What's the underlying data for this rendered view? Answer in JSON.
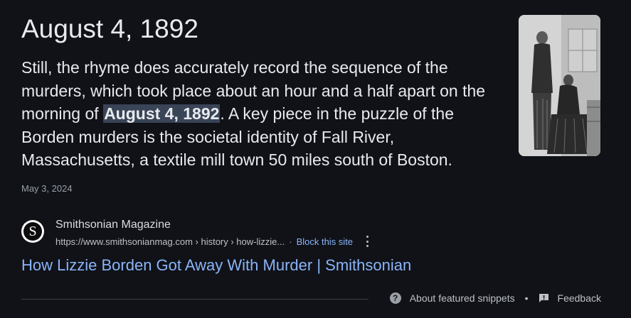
{
  "featured_snippet": {
    "answer_title": "August 4, 1892",
    "text_before": "Still, the rhyme does accurately record the sequence of the murders, which took place about an hour and a half apart on the morning of ",
    "text_highlight": "August 4, 1892",
    "text_after": ". A key piece in the puzzle of the Borden murders is the societal identity of Fall River, Massachusetts, a textile mill town 50 miles south of Boston.",
    "date": "May 3, 2024",
    "thumbnail_icon": "courtroom-illustration-image"
  },
  "source": {
    "favicon_letter": "S",
    "name": "Smithsonian Magazine",
    "url": "https://www.smithsonianmag.com › history › how-lizzie...",
    "separator": "·",
    "block_label": "Block this site",
    "more_icon": "more-vert-icon"
  },
  "result": {
    "title": "How Lizzie Borden Got Away With Murder | Smithsonian"
  },
  "footer": {
    "about_label": "About featured snippets",
    "bullet": "•",
    "feedback_label": "Feedback",
    "help_icon_glyph": "?"
  },
  "colors": {
    "background": "#101218",
    "text": "#e8eaed",
    "link": "#8ab4f8",
    "highlight": "#394457",
    "muted": "#9aa0a6"
  }
}
